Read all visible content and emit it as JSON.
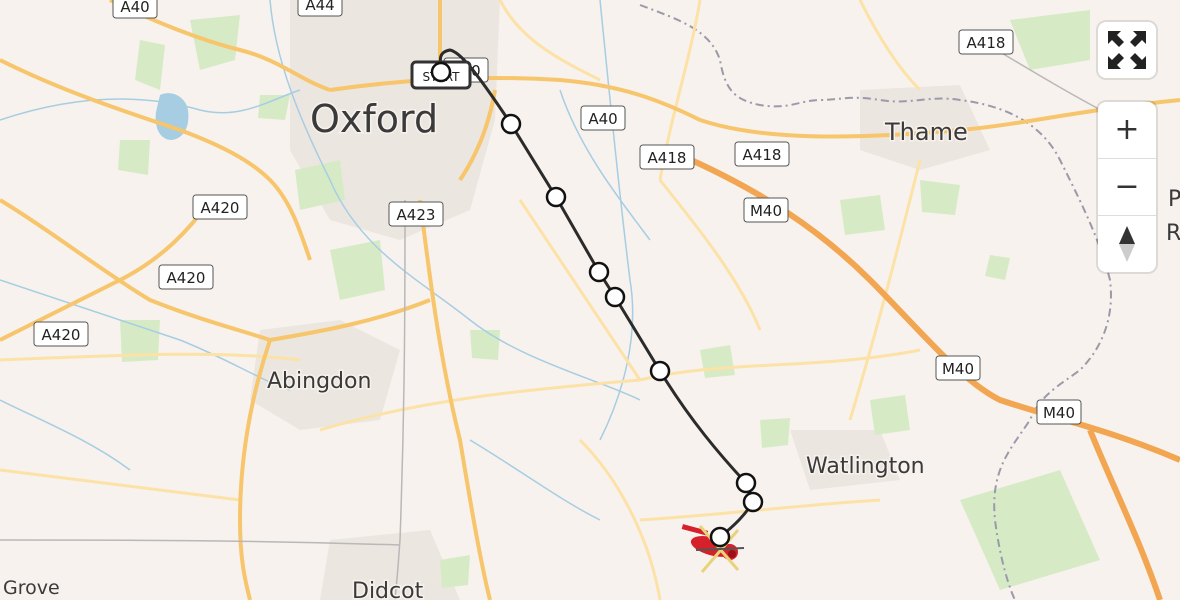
{
  "map": {
    "places": [
      {
        "name": "Oxford",
        "size": "large"
      },
      {
        "name": "Thame",
        "size": "medium"
      },
      {
        "name": "Abingdon",
        "size": "medium"
      },
      {
        "name": "Watlington",
        "size": "medium"
      },
      {
        "name": "Didcot",
        "size": "medium"
      },
      {
        "name": "Grove",
        "size": "small"
      },
      {
        "name": "P",
        "size": "medium"
      },
      {
        "name": "Ris",
        "size": "medium"
      }
    ],
    "road_labels": [
      "A40",
      "A44",
      "A40",
      "A40",
      "A418",
      "A418",
      "A418",
      "M40",
      "A420",
      "A423",
      "A420",
      "A420",
      "M40",
      "M40"
    ],
    "route": {
      "start_label": "START",
      "line_color": "#2b2b2b",
      "waypoint_count": 9,
      "end_marker": "helicopter-icon",
      "end_marker_color": "#d6202a"
    }
  },
  "controls": {
    "fullscreen_icon": "fullscreen-icon",
    "zoom_in_label": "+",
    "zoom_out_label": "−",
    "compass_icon": "compass-icon"
  }
}
